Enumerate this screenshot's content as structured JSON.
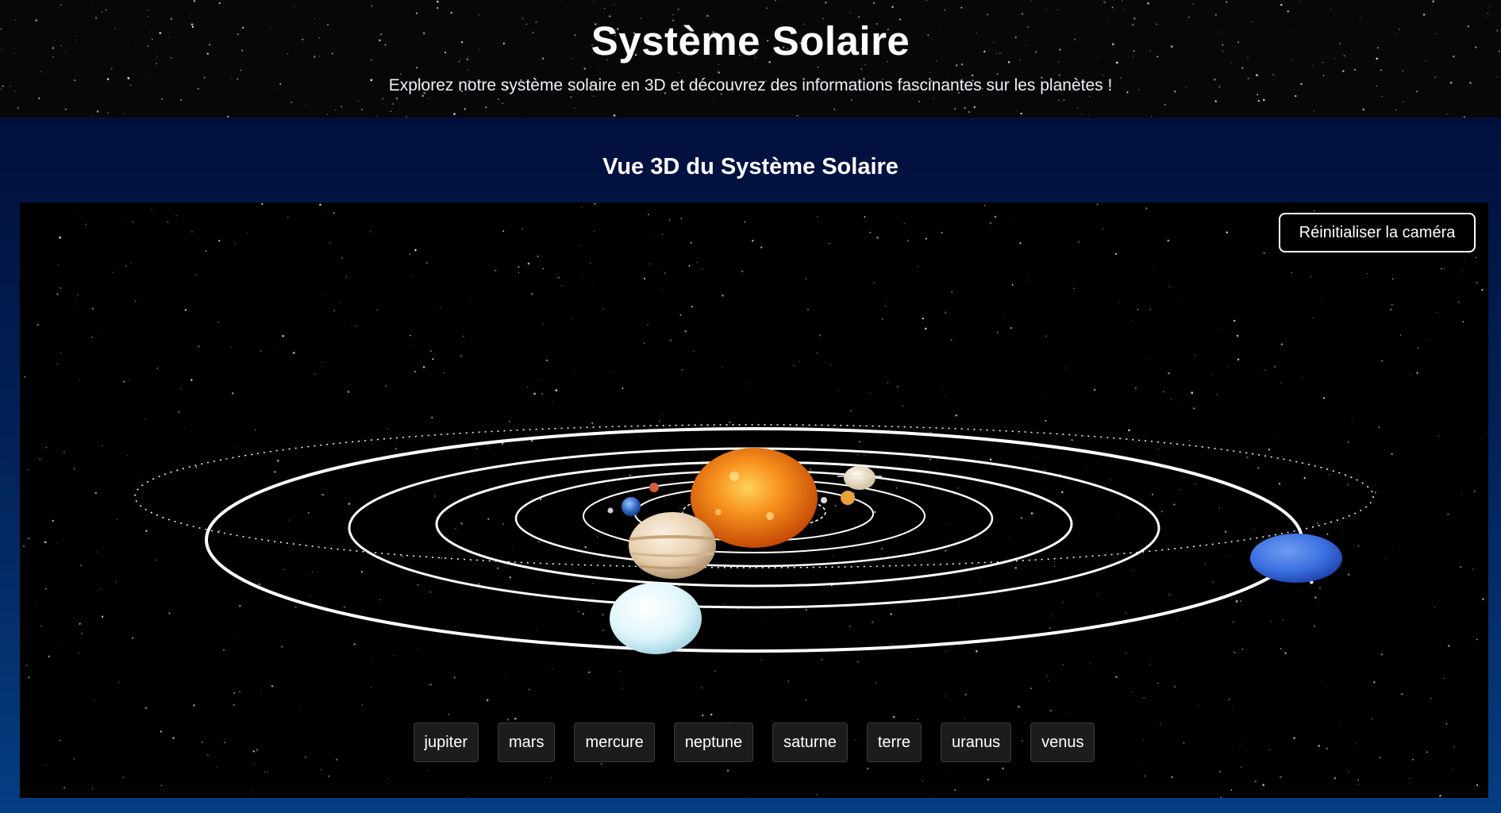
{
  "header": {
    "title": "Système Solaire",
    "subtitle": "Explorez notre système solaire en 3D et découvrez des informations fascinantes sur les planètes !"
  },
  "section": {
    "title": "Vue 3D du Système Solaire"
  },
  "viewer": {
    "reset_label": "Réinitialiser la caméra",
    "planet_buttons": [
      "jupiter",
      "mars",
      "mercure",
      "neptune",
      "saturne",
      "terre",
      "uranus",
      "venus"
    ]
  },
  "colors": {
    "header_bg": "#070709",
    "section_bg_top": "#020f3c",
    "section_bg_bottom": "#053e83",
    "viewport_bg": "#000000",
    "orbit": "#ffffff",
    "sun": "#f07a12",
    "neptune": "#3a6fe0",
    "uranus": "#d8f4fb"
  }
}
